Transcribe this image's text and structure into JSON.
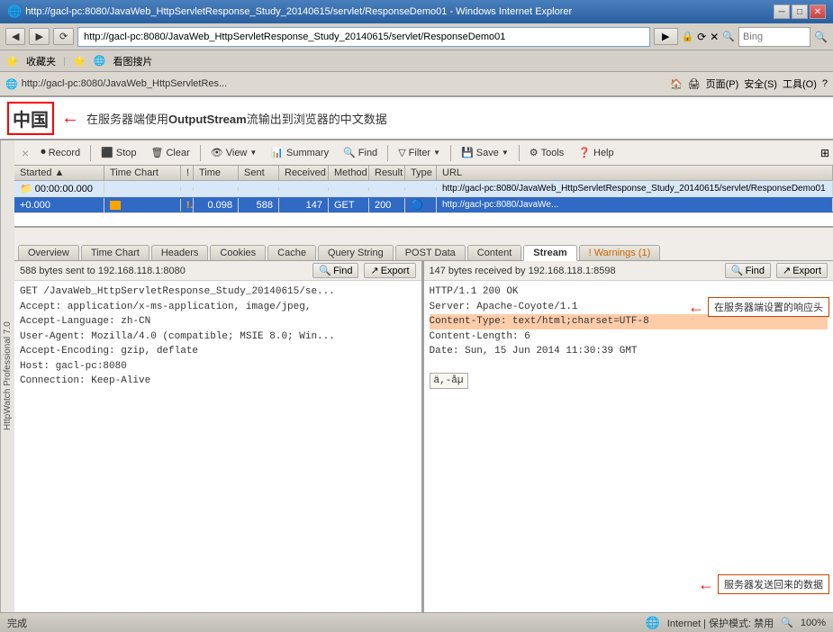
{
  "window": {
    "title": "http://gacl-pc:8080/JavaWeb_HttpServletResponse_Study_20140615/servlet/ResponseDemo01 - Windows Internet Explorer",
    "icon": "🌐"
  },
  "browser": {
    "back_label": "◀",
    "forward_label": "▶",
    "address": "http://gacl-pc:8080/JavaWeb_HttpServletResponse_Study_20140615/servlet/ResponseDemo01",
    "search_placeholder": "Bing",
    "refresh_label": "⟳"
  },
  "favbar": {
    "favorites_label": "收藏夹",
    "item1_label": "看图搜片"
  },
  "pagebar": {
    "address_short": "http://gacl-pc:8080/JavaWeb_HttpServletRes...",
    "page_label": "页面(P)",
    "safety_label": "安全(S)",
    "tools_label": "工具(O)",
    "help_label": "?"
  },
  "chinese_area": {
    "big_text": "中国",
    "annotation": "在服务器端使用OutputStream流输出到浏览器的中文数据"
  },
  "httpwatch": {
    "label": "HttpWatch Professional 7.0",
    "close_label": "×",
    "record_label": "Record",
    "stop_label": "Stop",
    "clear_label": "Clear",
    "view_label": "View",
    "summary_label": "Summary",
    "find_label": "Find",
    "filter_label": "Filter",
    "save_label": "Save",
    "tools_label": "Tools",
    "help_label": "Help"
  },
  "table": {
    "headers": [
      "Started",
      "Time Chart",
      "!",
      "Time",
      "Sent",
      "Received",
      "Method",
      "Result",
      "Type",
      "URL"
    ],
    "row1": {
      "started": "00:00:00.000",
      "timechart": "",
      "excl": "",
      "time": "",
      "sent": "",
      "received": "",
      "method": "",
      "result": "",
      "type": "",
      "url": "http://gacl-pc:8080/JavaWeb_HttpServletResponse_Study_20140615/servlet/ResponseDemo01"
    },
    "row2": {
      "started": "+0.000",
      "timechart": "",
      "excl": "!",
      "time": "0.098",
      "sent": "588",
      "received": "147",
      "method": "GET",
      "result": "200",
      "type": "",
      "url": "http://gacl-pc:8080/JavaWe..."
    }
  },
  "tabs": {
    "items": [
      "Overview",
      "Time Chart",
      "Headers",
      "Cookies",
      "Cache",
      "Query String",
      "POST Data",
      "Content",
      "Stream",
      "! Warnings (1)"
    ]
  },
  "detail": {
    "left": {
      "info": "588 bytes sent to 192.168.118.1:8080",
      "find_label": "Find",
      "export_label": "Export",
      "content": "GET /JavaWeb_HttpServletResponse_Study_20140615/se...\nAccept: application/x-ms-application, image/jpeg,\nAccept-Language: zh-CN\nUser-Agent: Mozilla/4.0 (compatible; MSIE 8.0; Win...\nAccept-Encoding: gzip, deflate\nHost: gacl-pc:8080\nConnection: Keep-Alive"
    },
    "right": {
      "info": "147 bytes received by 192.168.118.1:8598",
      "find_label": "Find",
      "export_label": "Export",
      "line1": "HTTP/1.1 200 OK",
      "line2": "Server: Apache-Coyote/1.1",
      "line3": "Content-Type: text/html;charset=UTF-8",
      "line4": "Content-Length: 6",
      "line5": "Date: Sun, 15 Jun 2014 11:30:39 GMT",
      "line6": "",
      "line7": "ä,-åµ",
      "annotation1": "在服务器端设置的响应头",
      "annotation2": "服务器发送回来的数据"
    }
  },
  "statusbar": {
    "status_label": "完成",
    "zone_label": "Internet | 保护模式: 禁用",
    "zoom_label": "100%"
  }
}
